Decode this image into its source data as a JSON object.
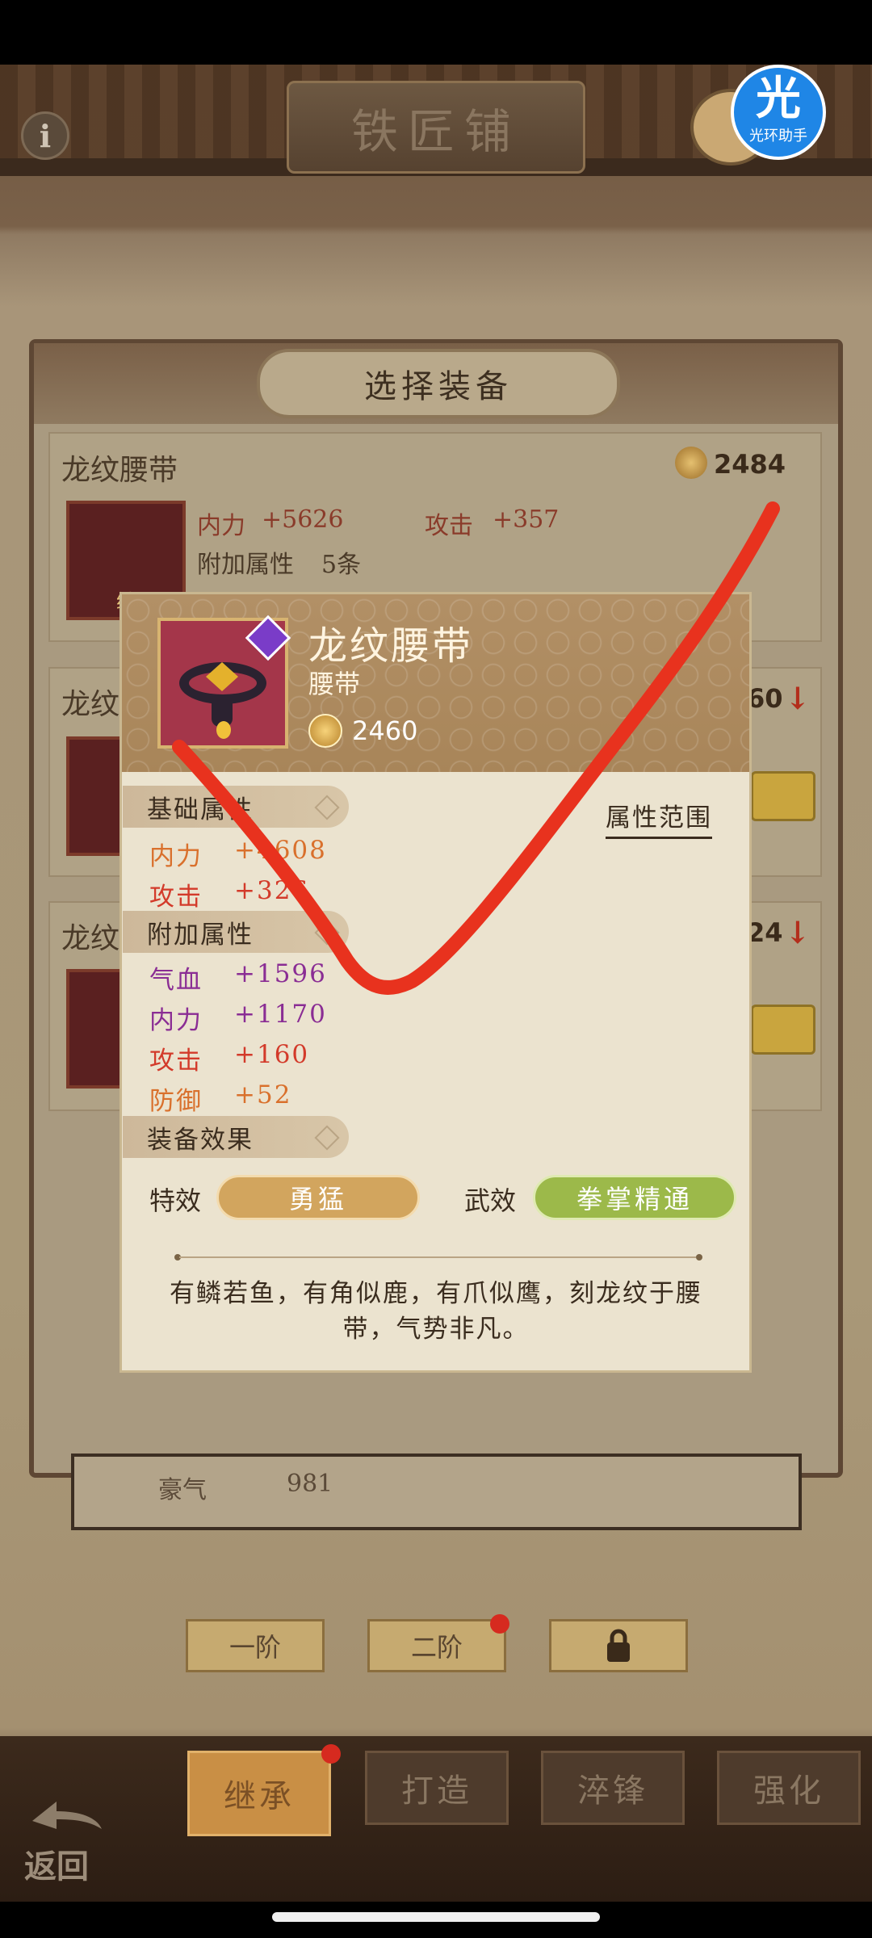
{
  "shop": {
    "title": "铁匠铺"
  },
  "helper": {
    "big": "光",
    "small": "光环助手"
  },
  "list_panel": {
    "title": "选择装备",
    "rows": [
      {
        "name": "龙纹腰带",
        "gem_value": "2484",
        "stat1_name": "内力",
        "stat1_val": "+5626",
        "stat2_name": "攻击",
        "stat2_val": "+357",
        "extra_label": "附加属性",
        "extra_val": "5条",
        "badge": "继"
      },
      {
        "name": "龙纹",
        "gem_value": "60"
      },
      {
        "name": "龙纹",
        "gem_value": "24"
      }
    ],
    "under_label": "豪气",
    "under_value": "981"
  },
  "steps": [
    "一阶",
    "二阶"
  ],
  "tabs": [
    {
      "label": "继承",
      "active": true
    },
    {
      "label": "打造",
      "active": false
    },
    {
      "label": "淬锋",
      "active": false
    },
    {
      "label": "强化",
      "active": false
    }
  ],
  "back": {
    "label": "返回"
  },
  "popup": {
    "name": "龙纹腰带",
    "type": "腰带",
    "score": "2460",
    "range_link": "属性范围",
    "sections": {
      "base": "基础属性",
      "extra": "附加属性",
      "effect": "装备效果"
    },
    "base_stats": [
      {
        "name": "内力",
        "value": "+4608"
      },
      {
        "name": "攻击",
        "value": "+326"
      }
    ],
    "extra_stats": [
      {
        "name": "气血",
        "value": "+1596"
      },
      {
        "name": "内力",
        "value": "+1170"
      },
      {
        "name": "攻击",
        "value": "+160"
      },
      {
        "name": "防御",
        "value": "+52"
      }
    ],
    "effect": {
      "special_label": "特效",
      "special_value": "勇猛",
      "martial_label": "武效",
      "martial_value": "拳掌精通"
    },
    "description": "有鳞若鱼，有角似鹿，有爪似鹰，刻龙纹于腰带，气势非凡。"
  },
  "colors": {
    "annotation": "#e8321e",
    "stat_orange": "#d9702c",
    "stat_red": "#d33a2a",
    "stat_purple": "#8a2d94"
  }
}
